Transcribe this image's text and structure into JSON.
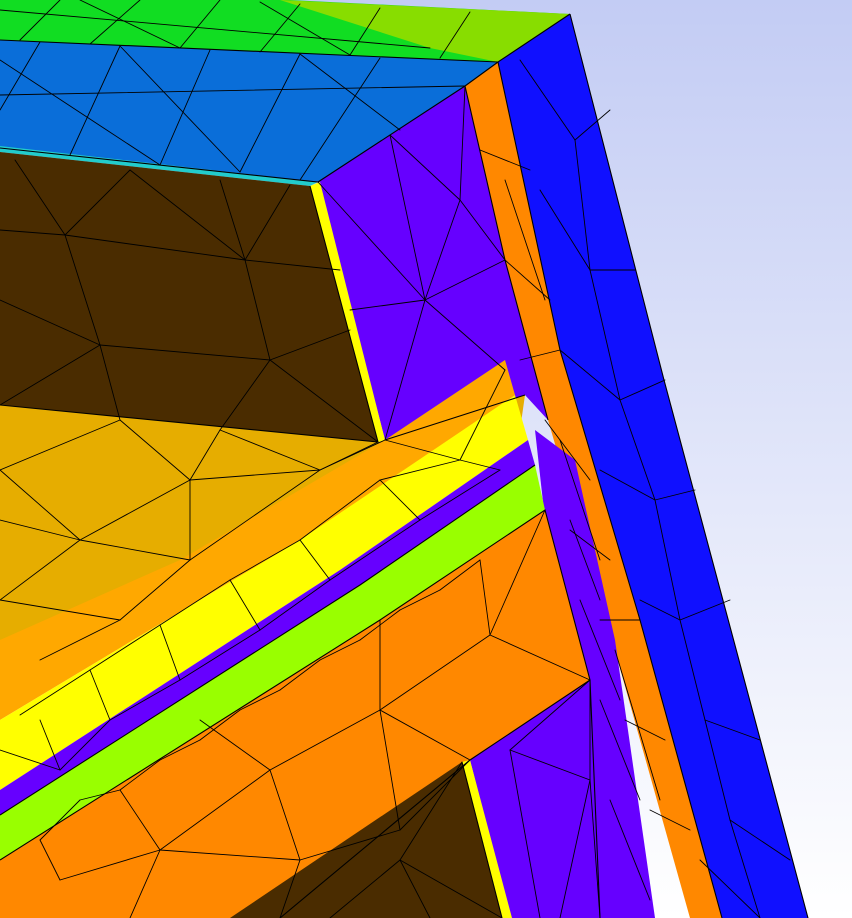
{
  "viewer": {
    "background_top": "#c3ccf4",
    "background_bottom": "#ffffff"
  },
  "materials": {
    "outer_shell": "#1010ff",
    "orange": "#ff8800",
    "dark_orange": "#ee7a00",
    "violet": "#6600ff",
    "dark_brown": "#4a2c00",
    "amber": "#e6ad00",
    "light_orange": "#ffa800",
    "yellow": "#ffff00",
    "lime": "#99ff00",
    "sky_blue": "#0a6ed9",
    "green": "#11dd22",
    "yellow_green": "#88dd00",
    "cyan_trim": "#22cccc"
  }
}
